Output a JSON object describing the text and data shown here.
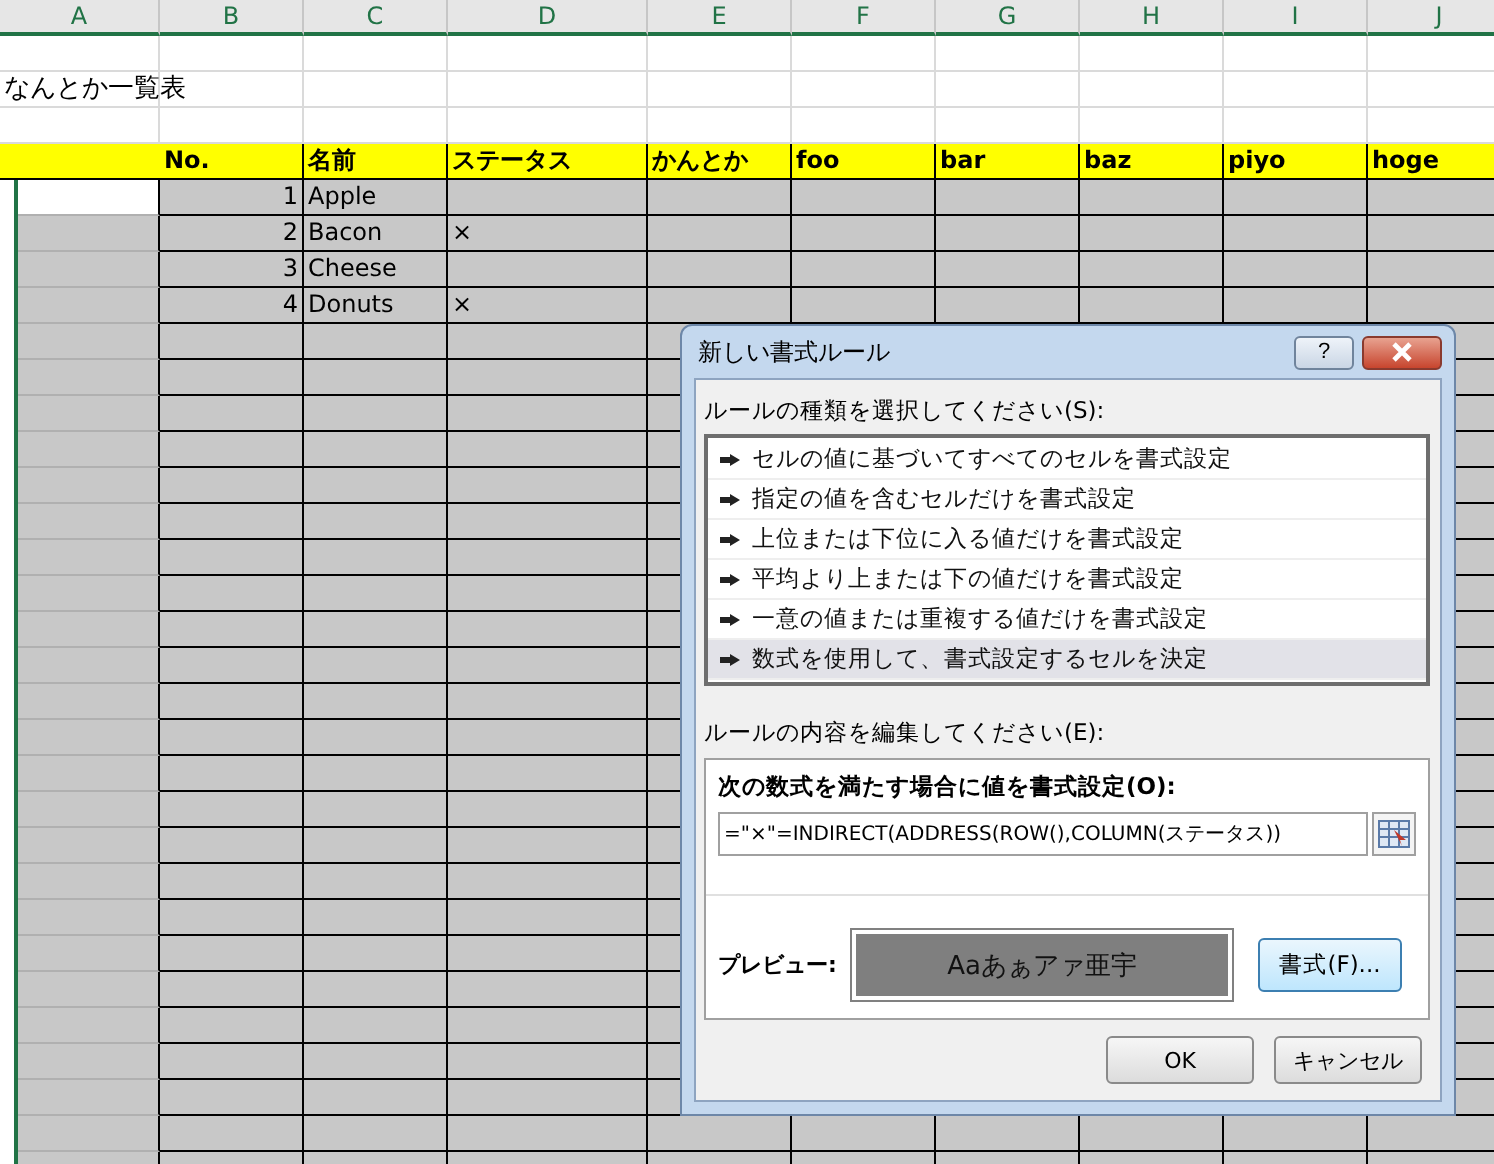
{
  "sheet": {
    "column_headers": [
      "A",
      "B",
      "C",
      "D",
      "E",
      "F",
      "G",
      "H",
      "I",
      "J"
    ],
    "title": "なんとか一覧表",
    "header_row": [
      "No.",
      "名前",
      "ステータス",
      "かんとか",
      "foo",
      "bar",
      "baz",
      "piyo",
      "hoge"
    ],
    "rows": [
      {
        "no": "1",
        "name": "Apple"
      },
      {
        "no": "2",
        "name": "Bacon",
        "status": "×"
      },
      {
        "no": "3",
        "name": "Cheese"
      },
      {
        "no": "4",
        "name": "Donuts",
        "status": "×"
      }
    ]
  },
  "dialog": {
    "title": "新しい書式ルール",
    "help_button": "?",
    "rule_type_label": "ルールの種類を選択してください(S):",
    "rule_types": [
      {
        "label": "セルの値に基づいてすべてのセルを書式設定",
        "selected": false
      },
      {
        "label": "指定の値を含むセルだけを書式設定",
        "selected": false
      },
      {
        "label": "上位または下位に入る値だけを書式設定",
        "selected": false
      },
      {
        "label": "平均より上または下の値だけを書式設定",
        "selected": false
      },
      {
        "label": "一意の値または重複する値だけを書式設定",
        "selected": false
      },
      {
        "label": "数式を使用して、書式設定するセルを決定",
        "selected": true
      }
    ],
    "edit_label": "ルールの内容を編集してください(E):",
    "formula_label": "次の数式を満たす場合に値を書式設定(O):",
    "formula": "=\"×\"=INDIRECT(ADDRESS(ROW(),COLUMN(ステータス))",
    "preview_label": "プレビュー:",
    "preview_text": "Aaあぁアァ亜宇",
    "format_button": "書式(F)...",
    "buttons": [
      "OK",
      "キャンセル"
    ]
  }
}
